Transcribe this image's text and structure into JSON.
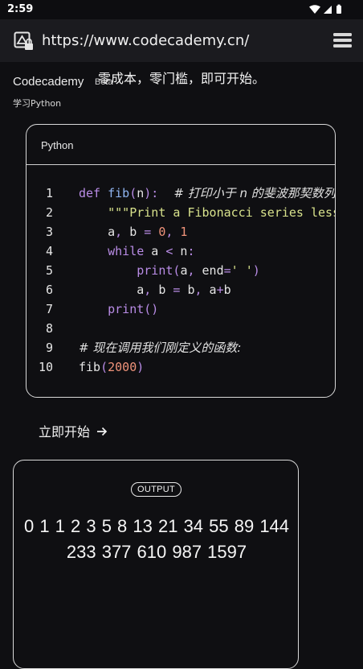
{
  "status_bar": {
    "time": "2:59"
  },
  "browser": {
    "url": "https://www.codecademy.cn/"
  },
  "header": {
    "brand": "Codecademy",
    "beta": "Beta",
    "tagline": "零成本，零门槛，即可开始。",
    "subtitle": "学习Python"
  },
  "code_card": {
    "language": "Python",
    "lines": [
      {
        "number": "1",
        "tokens": [
          {
            "t": "def ",
            "c": "kw"
          },
          {
            "t": "fib",
            "c": "fn"
          },
          {
            "t": "(",
            "c": "op"
          },
          {
            "t": "n",
            "c": "plain"
          },
          {
            "t": "):",
            "c": "op"
          },
          {
            "t": "    # 打印小于 n 的斐波那契数列",
            "c": "comment"
          }
        ]
      },
      {
        "number": "2",
        "tokens": [
          {
            "t": "    ",
            "c": "plain"
          },
          {
            "t": "\"\"\"Print a Fibonacci series less than n.\"\"\"",
            "c": "str"
          }
        ]
      },
      {
        "number": "3",
        "tokens": [
          {
            "t": "    a",
            "c": "plain"
          },
          {
            "t": ",",
            "c": "op"
          },
          {
            "t": " b ",
            "c": "plain"
          },
          {
            "t": "=",
            "c": "op"
          },
          {
            "t": " 0",
            "c": "num"
          },
          {
            "t": ",",
            "c": "op"
          },
          {
            "t": " 1",
            "c": "num"
          }
        ]
      },
      {
        "number": "4",
        "tokens": [
          {
            "t": "    ",
            "c": "plain"
          },
          {
            "t": "while",
            "c": "kw"
          },
          {
            "t": " a ",
            "c": "plain"
          },
          {
            "t": "<",
            "c": "op"
          },
          {
            "t": " n",
            "c": "plain"
          },
          {
            "t": ":",
            "c": "op"
          }
        ]
      },
      {
        "number": "5",
        "tokens": [
          {
            "t": "        ",
            "c": "plain"
          },
          {
            "t": "print",
            "c": "kw"
          },
          {
            "t": "(",
            "c": "op"
          },
          {
            "t": "a",
            "c": "plain"
          },
          {
            "t": ",",
            "c": "op"
          },
          {
            "t": " end",
            "c": "plain"
          },
          {
            "t": "=",
            "c": "op"
          },
          {
            "t": "' '",
            "c": "str"
          },
          {
            "t": ")",
            "c": "op"
          }
        ]
      },
      {
        "number": "6",
        "tokens": [
          {
            "t": "        a",
            "c": "plain"
          },
          {
            "t": ",",
            "c": "op"
          },
          {
            "t": " b ",
            "c": "plain"
          },
          {
            "t": "=",
            "c": "op"
          },
          {
            "t": " b",
            "c": "plain"
          },
          {
            "t": ",",
            "c": "op"
          },
          {
            "t": " a",
            "c": "plain"
          },
          {
            "t": "+",
            "c": "op"
          },
          {
            "t": "b",
            "c": "plain"
          }
        ]
      },
      {
        "number": "7",
        "tokens": [
          {
            "t": "    ",
            "c": "plain"
          },
          {
            "t": "print",
            "c": "kw"
          },
          {
            "t": "()",
            "c": "op"
          }
        ]
      },
      {
        "number": "8",
        "tokens": []
      },
      {
        "number": "9",
        "tokens": [
          {
            "t": "# 现在调用我们刚定义的函数:",
            "c": "comment"
          }
        ]
      },
      {
        "number": "10",
        "tokens": [
          {
            "t": "fib",
            "c": "plain"
          },
          {
            "t": "(",
            "c": "op"
          },
          {
            "t": "2000",
            "c": "num"
          },
          {
            "t": ")",
            "c": "op"
          }
        ]
      }
    ]
  },
  "cta": {
    "label": "立即开始",
    "icon": "arrow-right-icon"
  },
  "output_card": {
    "badge": "OUTPUT",
    "text": "0 1 1 2 3 5 8 13 21 34 55 89 144 233 377 610 987 1597"
  },
  "colors": {
    "background": "#0f0f12",
    "keyword": "#b98ce6",
    "function": "#8fb4f0",
    "string": "#d8e28c",
    "number": "#f0937a"
  }
}
